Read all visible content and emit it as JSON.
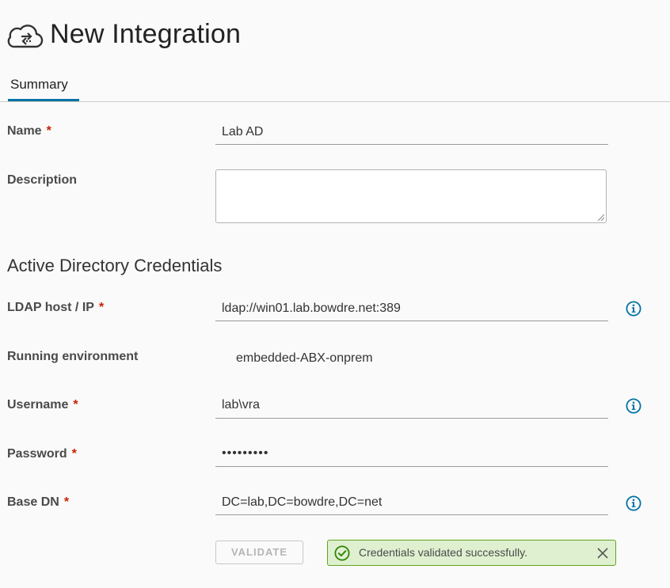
{
  "header": {
    "title": "New Integration",
    "icon": "cloud-integration-icon"
  },
  "tabs": [
    {
      "label": "Summary",
      "active": true
    }
  ],
  "form": {
    "name": {
      "label": "Name",
      "required_mark": "*",
      "value": "Lab AD"
    },
    "description": {
      "label": "Description",
      "value": ""
    },
    "section_title": "Active Directory Credentials",
    "ldap_host": {
      "label": "LDAP host / IP",
      "required_mark": "*",
      "value": "ldap://win01.lab.bowdre.net:389"
    },
    "running_environment": {
      "label": "Running environment",
      "value": "embedded-ABX-onprem"
    },
    "username": {
      "label": "Username",
      "required_mark": "*",
      "value": "lab\\vra"
    },
    "password": {
      "label": "Password",
      "required_mark": "*",
      "value": "•••••••••"
    },
    "base_dn": {
      "label": "Base DN",
      "required_mark": "*",
      "value": "DC=lab,DC=bowdre,DC=net"
    }
  },
  "actions": {
    "validate_label": "VALIDATE"
  },
  "alert": {
    "type": "success",
    "message": "Credentials validated successfully."
  },
  "colors": {
    "accent": "#0072a3",
    "required": "#c92100",
    "success_bg": "#dff0d0",
    "success_border": "#62a420",
    "info_icon": "#0072a3"
  }
}
